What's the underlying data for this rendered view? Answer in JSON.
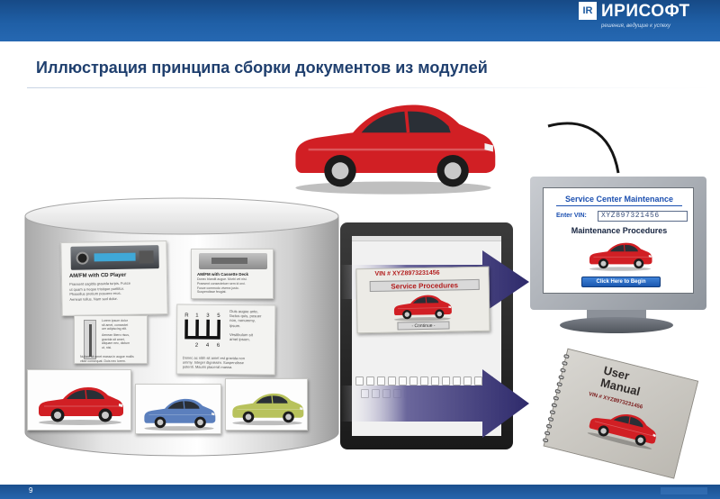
{
  "brand": {
    "logo_mark": "IR",
    "name": "ИРИСОФТ",
    "slogan": "решения, ведущие к успеху"
  },
  "slide": {
    "title": "Иллюстрация принципа сборки документов из модулей",
    "page_number": "9"
  },
  "cylinder_modules": {
    "radio_cd": {
      "title": "AM/FM with CD Player",
      "text": "Praesent sagittis gravida turpis. Fusce\nut quam a neque tristique porttitor.\nPhasellus pretium posuere eros.\nAenean tellus. Nam sed dolor."
    },
    "radio_cassette": {
      "title": "AM/FM with Cassette Deck",
      "text": "Donec blandit augue. Morbi vel nisi.\nPraesent consectetuer sem id orci.\nFusce commodo viverra justo.\nSuspendisse feugiat."
    },
    "shifter_text_1": "Lorem ipsum dolor\nsit amet, consectet\nuer adipiscing elit.",
    "shifter_text_2": "Aenean libero risus,\ngravida sit amet,\naliquam nec, dictum\nut, nisi.",
    "shifter_text_3": "Nullam sit amet massa in augue mollis\nvitae consequat. Duis nec lorem.",
    "gearbox": {
      "gears_top": [
        "R",
        "1",
        "3",
        "5"
      ],
      "gears_bottom": [
        "2",
        "4",
        "6"
      ],
      "text_top": "Duis augue ante,\nfactus quis, posuer\nnon, nonummy,\nipsum.\n\nVestibulum sit\namet ipsum.",
      "text_bottom": "Donec ac nibh sit amet est gravida non\nummy. Integer dignissim. Suspendisse\npotenti. Mauris placerat massa."
    }
  },
  "tablet": {
    "vin_text": "VIN # XYZ8973231456",
    "service_label": "Service Procedures",
    "continue_label": "- Continue -"
  },
  "monitor": {
    "title": "Service Center Maintenance",
    "vin_label": "Enter VIN:",
    "vin_value": "XYZ897321456",
    "subtitle": "Maintenance Procedures",
    "button_label": "Click Here to Begin"
  },
  "manual": {
    "title": "User\nManual",
    "vin": "VIN # XYZ8973231456"
  },
  "colors": {
    "header_blue": "#1f5fa6",
    "title_color": "#1f3f6e",
    "car_red": "#d11f24",
    "car_blue": "#5b7fbd",
    "car_lime": "#b8c25c",
    "arrow_purple": "#2e2a6b"
  },
  "icons": [
    "car-image",
    "database-cylinder-icon",
    "arrow-right-icon",
    "monitor-icon",
    "tablet-icon",
    "manual-book-icon",
    "cable-icon"
  ]
}
